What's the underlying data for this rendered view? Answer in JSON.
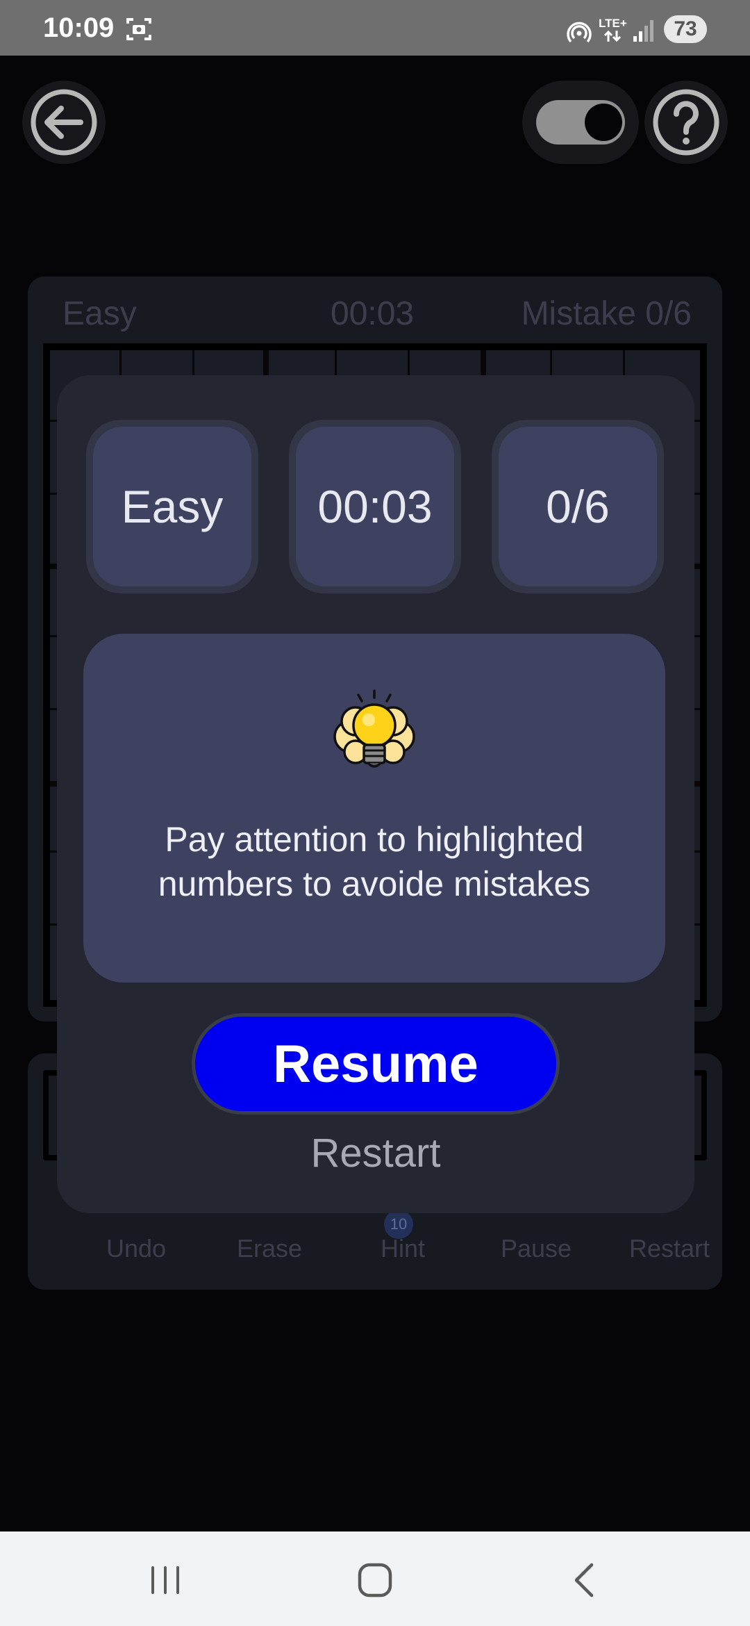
{
  "status_bar": {
    "time": "10:09",
    "network": "LTE+",
    "battery": "73",
    "icons": [
      "screenshot-icon",
      "hotspot-icon",
      "signal-icon"
    ]
  },
  "top_bar": {
    "icons": [
      "back-arrow-icon",
      "theme-toggle",
      "help-icon"
    ]
  },
  "board": {
    "difficulty": "Easy",
    "timer": "00:03",
    "mistakes": "Mistake 0/6"
  },
  "tools": {
    "undo": "Undo",
    "erase": "Erase",
    "hint": "Hint",
    "hint_count": "10",
    "pause": "Pause",
    "restart": "Restart"
  },
  "pause_dialog": {
    "difficulty": "Easy",
    "timer": "00:03",
    "mistakes": "0/6",
    "tip_icon": "brain-lightbulb-icon",
    "tip_line1": "Pay attention to highlighted",
    "tip_line2": "numbers to avoide mistakes",
    "resume_label": "Resume",
    "restart_label": "Restart",
    "accent_color": "#0000f0"
  },
  "nav_bar": {
    "icons": [
      "recents-icon",
      "home-icon",
      "back-icon"
    ]
  }
}
